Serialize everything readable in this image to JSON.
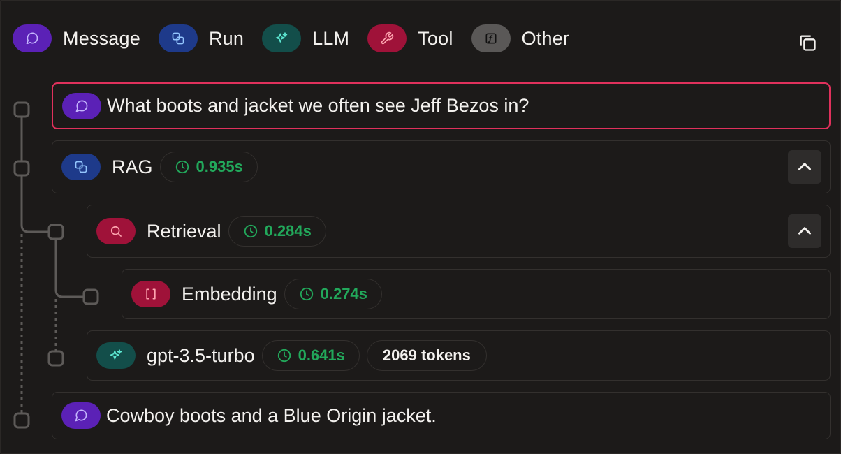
{
  "legend": {
    "items": [
      {
        "label": "Message",
        "icon": "message-bubble-icon",
        "color": "#5b21b6"
      },
      {
        "label": "Run",
        "icon": "run-link-icon",
        "color": "#1e3a8a"
      },
      {
        "label": "LLM",
        "icon": "sparkles-icon",
        "color": "#134e4a"
      },
      {
        "label": "Tool",
        "icon": "wrench-icon",
        "color": "#9f1239"
      },
      {
        "label": "Other",
        "icon": "function-icon",
        "color": "#5a5857"
      }
    ]
  },
  "toolbar": {
    "copy_icon": "copy-icon"
  },
  "trace": {
    "user_message": "What boots and jacket we often see Jeff Bezos in?",
    "rag": {
      "title": "RAG",
      "duration": "0.935s"
    },
    "retrieval": {
      "title": "Retrieval",
      "duration": "0.284s"
    },
    "embedding": {
      "title": "Embedding",
      "duration": "0.274s"
    },
    "llm": {
      "title": "gpt-3.5-turbo",
      "duration": "0.641s",
      "tokens": "2069 tokens"
    },
    "assistant_message": "Cowboy boots and a Blue Origin jacket."
  },
  "colors": {
    "accent_selected": "#e0315c",
    "duration_green": "#22a85b",
    "background": "#1c1a19"
  }
}
